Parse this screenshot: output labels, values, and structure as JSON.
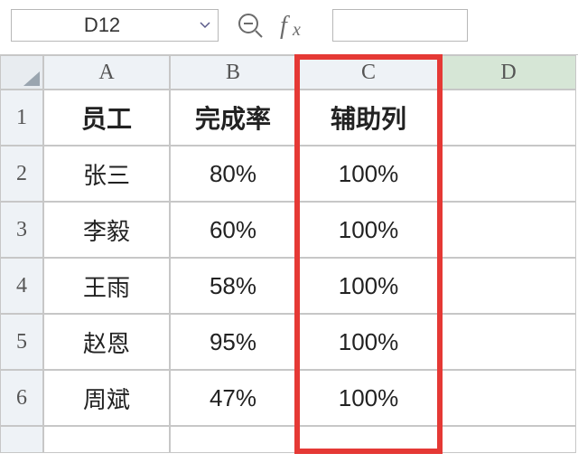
{
  "toolbar": {
    "name_box_value": "D12",
    "fx_label": "fx"
  },
  "columns": [
    "A",
    "B",
    "C",
    "D"
  ],
  "rows": [
    "1",
    "2",
    "3",
    "4",
    "5",
    "6"
  ],
  "headers": {
    "A": "员工",
    "B": "完成率",
    "C": "辅助列"
  },
  "data": [
    {
      "A": "张三",
      "B": "80%",
      "C": "100%"
    },
    {
      "A": "李毅",
      "B": "60%",
      "C": "100%"
    },
    {
      "A": "王雨",
      "B": "58%",
      "C": "100%"
    },
    {
      "A": "赵恩",
      "B": "95%",
      "C": "100%"
    },
    {
      "A": "周斌",
      "B": "47%",
      "C": "100%"
    }
  ],
  "active_column": "D"
}
